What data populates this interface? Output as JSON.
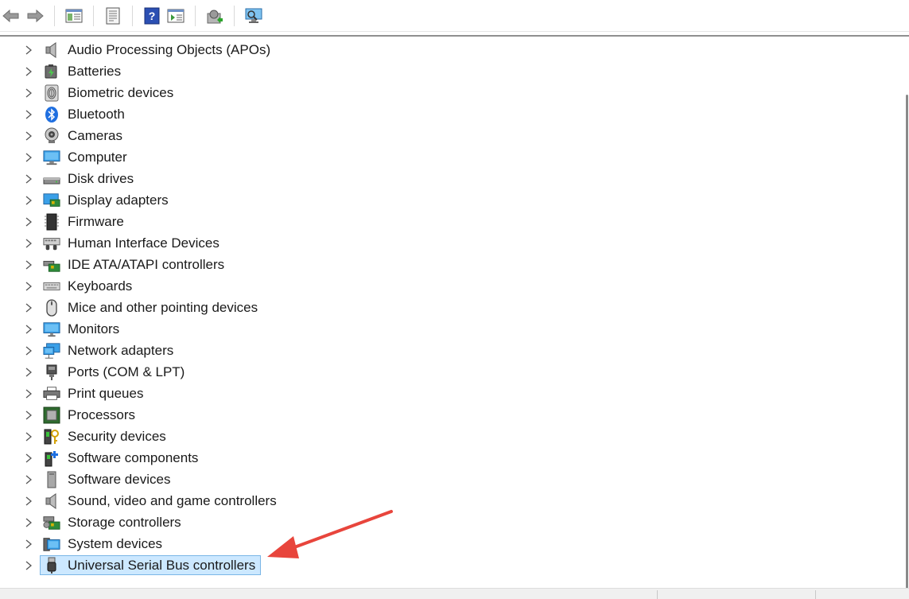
{
  "toolbar": {
    "buttons": [
      {
        "icon": "back-arrow-icon"
      },
      {
        "icon": "forward-arrow-icon"
      },
      {
        "icon": "show-hide-console-tree-icon"
      },
      {
        "icon": "properties-icon"
      },
      {
        "icon": "help-icon"
      },
      {
        "icon": "show-action-pane-icon"
      },
      {
        "icon": "update-driver-icon"
      },
      {
        "icon": "scan-hardware-changes-icon"
      }
    ]
  },
  "tree": {
    "items": [
      {
        "label": "Audio Processing Objects (APOs)",
        "icon": "speaker-icon"
      },
      {
        "label": "Batteries",
        "icon": "battery-icon"
      },
      {
        "label": "Biometric devices",
        "icon": "fingerprint-icon"
      },
      {
        "label": "Bluetooth",
        "icon": "bluetooth-icon"
      },
      {
        "label": "Cameras",
        "icon": "camera-icon"
      },
      {
        "label": "Computer",
        "icon": "computer-icon"
      },
      {
        "label": "Disk drives",
        "icon": "disk-drive-icon"
      },
      {
        "label": "Display adapters",
        "icon": "display-adapter-icon"
      },
      {
        "label": "Firmware",
        "icon": "firmware-chip-icon"
      },
      {
        "label": "Human Interface Devices",
        "icon": "hid-icon"
      },
      {
        "label": "IDE ATA/ATAPI controllers",
        "icon": "ide-controller-icon"
      },
      {
        "label": "Keyboards",
        "icon": "keyboard-icon"
      },
      {
        "label": "Mice and other pointing devices",
        "icon": "mouse-icon"
      },
      {
        "label": "Monitors",
        "icon": "monitor-icon"
      },
      {
        "label": "Network adapters",
        "icon": "network-adapter-icon"
      },
      {
        "label": "Ports (COM & LPT)",
        "icon": "port-icon"
      },
      {
        "label": "Print queues",
        "icon": "printer-icon"
      },
      {
        "label": "Processors",
        "icon": "processor-icon"
      },
      {
        "label": "Security devices",
        "icon": "security-key-icon"
      },
      {
        "label": "Software components",
        "icon": "software-component-icon"
      },
      {
        "label": "Software devices",
        "icon": "software-device-icon"
      },
      {
        "label": "Sound, video and game controllers",
        "icon": "sound-icon"
      },
      {
        "label": "Storage controllers",
        "icon": "storage-controller-icon"
      },
      {
        "label": "System devices",
        "icon": "system-device-icon"
      },
      {
        "label": "Universal Serial Bus controllers",
        "icon": "usb-icon",
        "selected": true
      }
    ]
  },
  "annotation": {
    "arrow_color": "#e8453c"
  },
  "colors": {
    "selection_bg": "#cce8ff",
    "selection_border": "#7ab6e6"
  }
}
